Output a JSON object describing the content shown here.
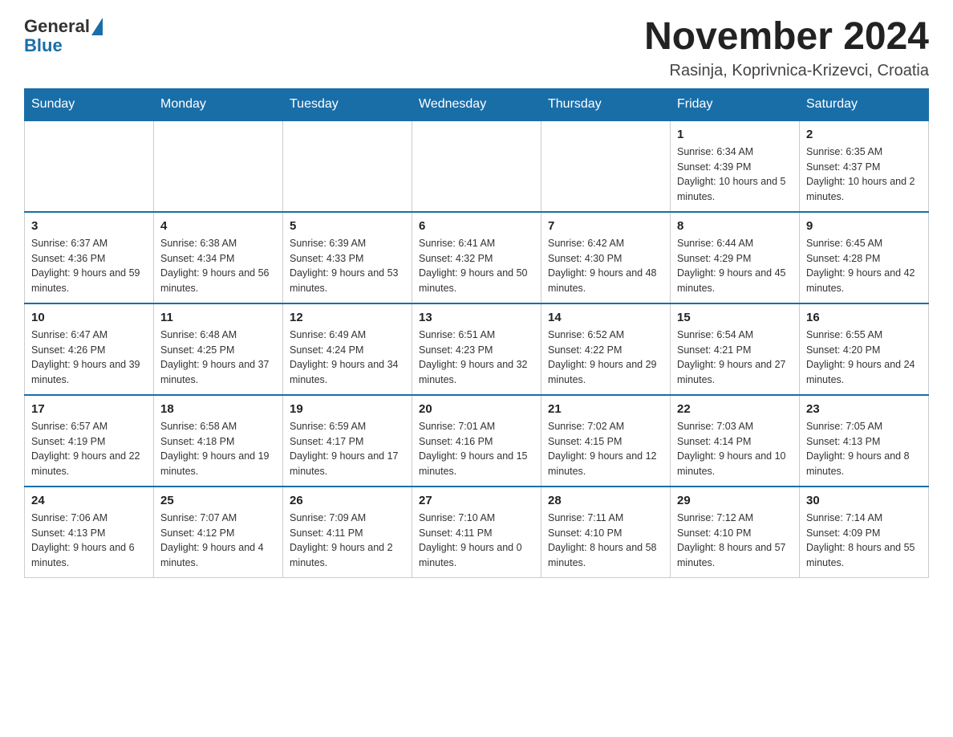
{
  "header": {
    "logo_general": "General",
    "logo_blue": "Blue",
    "month_title": "November 2024",
    "location": "Rasinja, Koprivnica-Krizevci, Croatia"
  },
  "days_of_week": [
    "Sunday",
    "Monday",
    "Tuesday",
    "Wednesday",
    "Thursday",
    "Friday",
    "Saturday"
  ],
  "weeks": [
    [
      {
        "day": "",
        "info": ""
      },
      {
        "day": "",
        "info": ""
      },
      {
        "day": "",
        "info": ""
      },
      {
        "day": "",
        "info": ""
      },
      {
        "day": "",
        "info": ""
      },
      {
        "day": "1",
        "info": "Sunrise: 6:34 AM\nSunset: 4:39 PM\nDaylight: 10 hours and 5 minutes."
      },
      {
        "day": "2",
        "info": "Sunrise: 6:35 AM\nSunset: 4:37 PM\nDaylight: 10 hours and 2 minutes."
      }
    ],
    [
      {
        "day": "3",
        "info": "Sunrise: 6:37 AM\nSunset: 4:36 PM\nDaylight: 9 hours and 59 minutes."
      },
      {
        "day": "4",
        "info": "Sunrise: 6:38 AM\nSunset: 4:34 PM\nDaylight: 9 hours and 56 minutes."
      },
      {
        "day": "5",
        "info": "Sunrise: 6:39 AM\nSunset: 4:33 PM\nDaylight: 9 hours and 53 minutes."
      },
      {
        "day": "6",
        "info": "Sunrise: 6:41 AM\nSunset: 4:32 PM\nDaylight: 9 hours and 50 minutes."
      },
      {
        "day": "7",
        "info": "Sunrise: 6:42 AM\nSunset: 4:30 PM\nDaylight: 9 hours and 48 minutes."
      },
      {
        "day": "8",
        "info": "Sunrise: 6:44 AM\nSunset: 4:29 PM\nDaylight: 9 hours and 45 minutes."
      },
      {
        "day": "9",
        "info": "Sunrise: 6:45 AM\nSunset: 4:28 PM\nDaylight: 9 hours and 42 minutes."
      }
    ],
    [
      {
        "day": "10",
        "info": "Sunrise: 6:47 AM\nSunset: 4:26 PM\nDaylight: 9 hours and 39 minutes."
      },
      {
        "day": "11",
        "info": "Sunrise: 6:48 AM\nSunset: 4:25 PM\nDaylight: 9 hours and 37 minutes."
      },
      {
        "day": "12",
        "info": "Sunrise: 6:49 AM\nSunset: 4:24 PM\nDaylight: 9 hours and 34 minutes."
      },
      {
        "day": "13",
        "info": "Sunrise: 6:51 AM\nSunset: 4:23 PM\nDaylight: 9 hours and 32 minutes."
      },
      {
        "day": "14",
        "info": "Sunrise: 6:52 AM\nSunset: 4:22 PM\nDaylight: 9 hours and 29 minutes."
      },
      {
        "day": "15",
        "info": "Sunrise: 6:54 AM\nSunset: 4:21 PM\nDaylight: 9 hours and 27 minutes."
      },
      {
        "day": "16",
        "info": "Sunrise: 6:55 AM\nSunset: 4:20 PM\nDaylight: 9 hours and 24 minutes."
      }
    ],
    [
      {
        "day": "17",
        "info": "Sunrise: 6:57 AM\nSunset: 4:19 PM\nDaylight: 9 hours and 22 minutes."
      },
      {
        "day": "18",
        "info": "Sunrise: 6:58 AM\nSunset: 4:18 PM\nDaylight: 9 hours and 19 minutes."
      },
      {
        "day": "19",
        "info": "Sunrise: 6:59 AM\nSunset: 4:17 PM\nDaylight: 9 hours and 17 minutes."
      },
      {
        "day": "20",
        "info": "Sunrise: 7:01 AM\nSunset: 4:16 PM\nDaylight: 9 hours and 15 minutes."
      },
      {
        "day": "21",
        "info": "Sunrise: 7:02 AM\nSunset: 4:15 PM\nDaylight: 9 hours and 12 minutes."
      },
      {
        "day": "22",
        "info": "Sunrise: 7:03 AM\nSunset: 4:14 PM\nDaylight: 9 hours and 10 minutes."
      },
      {
        "day": "23",
        "info": "Sunrise: 7:05 AM\nSunset: 4:13 PM\nDaylight: 9 hours and 8 minutes."
      }
    ],
    [
      {
        "day": "24",
        "info": "Sunrise: 7:06 AM\nSunset: 4:13 PM\nDaylight: 9 hours and 6 minutes."
      },
      {
        "day": "25",
        "info": "Sunrise: 7:07 AM\nSunset: 4:12 PM\nDaylight: 9 hours and 4 minutes."
      },
      {
        "day": "26",
        "info": "Sunrise: 7:09 AM\nSunset: 4:11 PM\nDaylight: 9 hours and 2 minutes."
      },
      {
        "day": "27",
        "info": "Sunrise: 7:10 AM\nSunset: 4:11 PM\nDaylight: 9 hours and 0 minutes."
      },
      {
        "day": "28",
        "info": "Sunrise: 7:11 AM\nSunset: 4:10 PM\nDaylight: 8 hours and 58 minutes."
      },
      {
        "day": "29",
        "info": "Sunrise: 7:12 AM\nSunset: 4:10 PM\nDaylight: 8 hours and 57 minutes."
      },
      {
        "day": "30",
        "info": "Sunrise: 7:14 AM\nSunset: 4:09 PM\nDaylight: 8 hours and 55 minutes."
      }
    ]
  ]
}
